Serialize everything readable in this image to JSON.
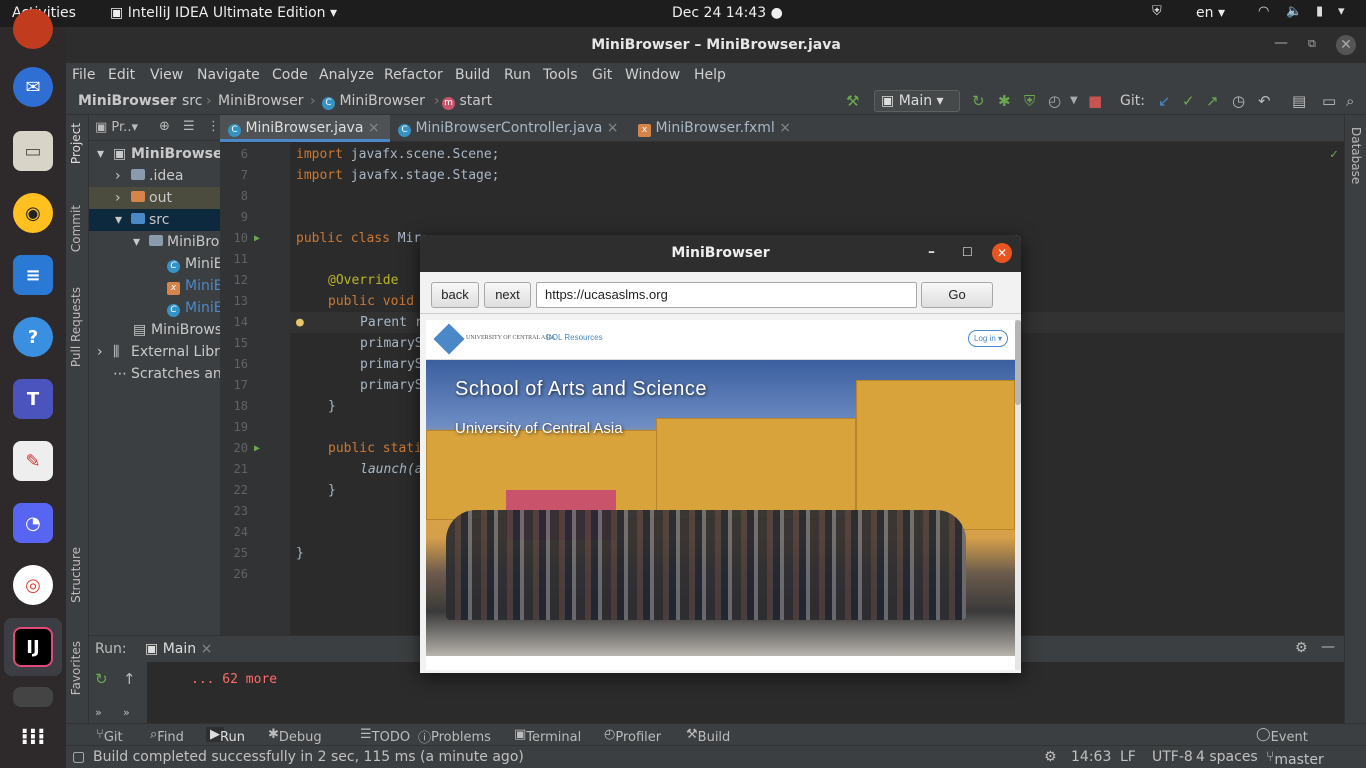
{
  "topbar": {
    "activities": "Activities",
    "app_menu": "IntelliJ IDEA Ultimate Edition",
    "clock": "Dec 24  14:43",
    "language": "en"
  },
  "window": {
    "title": "MiniBrowser – MiniBrowser.java"
  },
  "menu": [
    "File",
    "Edit",
    "View",
    "Navigate",
    "Code",
    "Analyze",
    "Refactor",
    "Build",
    "Run",
    "Tools",
    "Git",
    "Window",
    "Help"
  ],
  "breadcrumbs": [
    "MiniBrowser",
    "src",
    "MiniBrowser",
    "MiniBrowser",
    "start"
  ],
  "toolbar": {
    "run_config": "Main",
    "git_label": "Git:"
  },
  "left_strip": [
    "Project",
    "Commit",
    "Pull Requests",
    "Structure",
    "Favorites"
  ],
  "right_strip": [
    "Database"
  ],
  "project": {
    "header": "Pr..",
    "tree": [
      {
        "label": "MiniBrowser",
        "kind": "module"
      },
      {
        "label": ".idea",
        "kind": "folder"
      },
      {
        "label": "out",
        "kind": "folder-out"
      },
      {
        "label": "src",
        "kind": "folder"
      },
      {
        "label": "MiniBro",
        "kind": "package"
      },
      {
        "label": "MiniE",
        "kind": "class"
      },
      {
        "label": "MiniE",
        "kind": "fxml"
      },
      {
        "label": "MiniE",
        "kind": "class"
      },
      {
        "label": "MiniBrows",
        "kind": "file"
      },
      {
        "label": "External Libr",
        "kind": "lib"
      },
      {
        "label": "Scratches and",
        "kind": "scratch"
      }
    ]
  },
  "tabs": [
    {
      "label": "MiniBrowser.java",
      "active": true
    },
    {
      "label": "MiniBrowserController.java",
      "active": false
    },
    {
      "label": "MiniBrowser.fxml",
      "active": false
    }
  ],
  "code": {
    "line_numbers": [
      "6",
      "7",
      "8",
      "9",
      "10",
      "11",
      "12",
      "13",
      "14",
      "15",
      "16",
      "17",
      "18",
      "19",
      "20",
      "21",
      "22",
      "23",
      "24",
      "25",
      "26"
    ],
    "lines": [
      {
        "kw": "import ",
        "text": "javafx.scene.Scene;"
      },
      {
        "kw": "import ",
        "text": "javafx.stage.Stage;"
      },
      {
        "kw": "",
        "text": ""
      },
      {
        "kw": "",
        "text": ""
      },
      {
        "kw": "public class ",
        "text": "Mir"
      },
      {
        "kw": "",
        "text": ""
      },
      {
        "ann": "@Override",
        "text": ""
      },
      {
        "kw": "public void",
        "text": ""
      },
      {
        "kw": "",
        "text": "Parent r"
      },
      {
        "kw": "",
        "text": "primaryS"
      },
      {
        "kw": "",
        "text": "primaryS"
      },
      {
        "kw": "",
        "text": "primaryS"
      },
      {
        "kw": "",
        "text": "}"
      },
      {
        "kw": "",
        "text": ""
      },
      {
        "kw": "public stati",
        "text": ""
      },
      {
        "kw": "",
        "text": "launch(a"
      },
      {
        "kw": "",
        "text": "}"
      },
      {
        "kw": "",
        "text": ""
      },
      {
        "kw": "",
        "text": ""
      },
      {
        "kw": "",
        "text": "}"
      },
      {
        "kw": "",
        "text": ""
      }
    ]
  },
  "run": {
    "label": "Run:",
    "tab": "Main",
    "output": "... 62 more"
  },
  "bottom_tools": [
    "Git",
    "Find",
    "Run",
    "Debug",
    "TODO",
    "Problems",
    "Terminal",
    "Profiler",
    "Build",
    "Event Log"
  ],
  "status": {
    "message": "Build completed successfully in 2 sec, 115 ms (a minute ago)",
    "position": "14:63",
    "line_sep": "LF",
    "encoding": "UTF-8",
    "indent": "4 spaces",
    "branch": "master"
  },
  "minibrowser": {
    "title": "MiniBrowser",
    "back": "back",
    "next": "next",
    "url": "https://ucasaslms.org",
    "go": "Go",
    "site_name": "UNIVERSITY OF CENTRAL ASIA",
    "site_link": "DOL Resources",
    "login": "Log in ▾",
    "hero_title": "School of Arts and Science",
    "hero_subtitle": "University of Central Asia"
  },
  "colors": {
    "accent": "#4a88c7",
    "keyword": "#cc7832",
    "annotation": "#bbb529",
    "ubuntu_orange": "#e95420"
  }
}
